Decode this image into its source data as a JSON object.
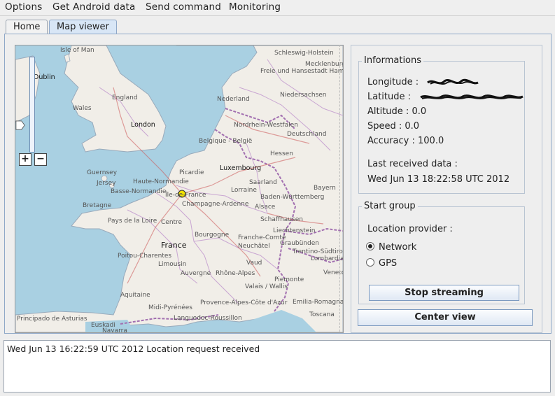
{
  "menubar": {
    "items": [
      "Options",
      "Get Android data",
      "Send command",
      "Monitoring"
    ]
  },
  "tabs": [
    {
      "label": "Home",
      "selected": false
    },
    {
      "label": "Map viewer",
      "selected": true
    }
  ],
  "map": {
    "labels": [
      "Isle of Man",
      "Dublin",
      "England",
      "Wales",
      "London",
      "Nederland",
      "Niedersachsen",
      "Nordrhein-Westfalen",
      "Deutschland",
      "Belgique - België",
      "Luxembourg",
      "Hessen",
      "Picardie",
      "Guernsey",
      "Jersey",
      "Basse-Normandie",
      "Haute-Normandie",
      "Île-de-France",
      "Champagne-Ardenne",
      "Lorraine",
      "Saarland",
      "Baden-Württemberg",
      "Bayern",
      "Bretagne",
      "Pays de la Loire",
      "Centre",
      "Alsace",
      "Bourgogne",
      "Franche-Comté",
      "Schaffhausen",
      "Liechtenstein",
      "France",
      "Poitou-Charentes",
      "Limousin",
      "Auvergne",
      "Rhône-Alpes",
      "Aquitaine",
      "Midi-Pyrénées",
      "Provence-Alpes-Côte d'Azur",
      "Languedoc-Roussillon",
      "Piemonte",
      "Lombardia",
      "Toscana",
      "Euskadi",
      "Principado de Asturias",
      "Navarra",
      "Schleswig-Holstein",
      "Mecklenburg",
      "Freie und Hansestadt Hamburg",
      "Valais / Wallis",
      "Neuchâtel",
      "Vaud",
      "Graubünden",
      "Trentino-Südtirol",
      "Emilia-Romagna",
      "Veneto"
    ],
    "zoom_level_fraction": 0.25,
    "zoom_in": "+",
    "zoom_out": "−"
  },
  "info": {
    "title": "Informations",
    "longitude_label": "Longitude :",
    "latitude_label": "Latitude :",
    "altitude_label": "Altitude :",
    "altitude": "0.0",
    "speed_label": "Speed :",
    "speed": "0.0",
    "accuracy_label": "Accuracy :",
    "accuracy": "100.0",
    "last_received_label": "Last received data :",
    "last_received": "Wed Jun 13 18:22:58 UTC 2012"
  },
  "start_group": {
    "title": "Start group",
    "provider_label": "Location provider :",
    "options": [
      {
        "label": "Network",
        "selected": true
      },
      {
        "label": "GPS",
        "selected": false
      }
    ],
    "stop_button": "Stop streaming"
  },
  "center_view_button": "Center view",
  "log": {
    "lines": [
      "Wed Jun 13 16:22:59 UTC 2012 Location request received"
    ]
  },
  "colors": {
    "sea": "#a9d0e2",
    "land": "#f1eee8",
    "border": "#a26fb0",
    "marker": "#f2e200"
  }
}
